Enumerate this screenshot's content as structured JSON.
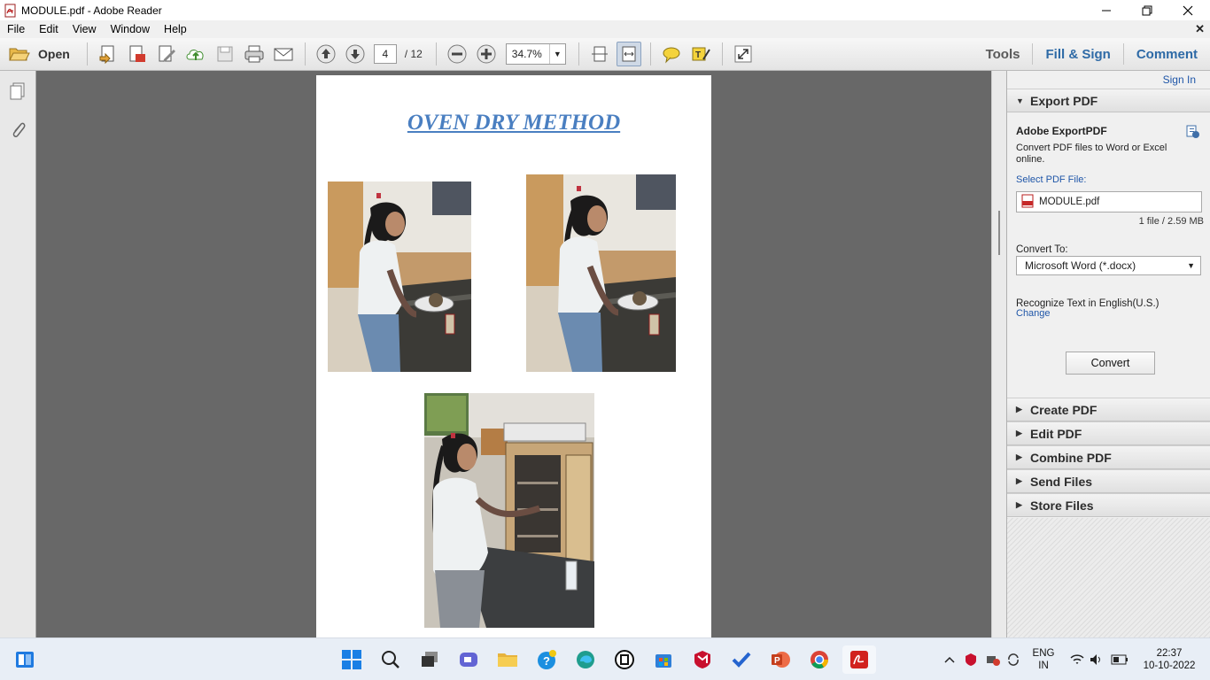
{
  "window": {
    "title": "MODULE.pdf - Adobe Reader"
  },
  "menu": {
    "items": [
      "File",
      "Edit",
      "View",
      "Window",
      "Help"
    ]
  },
  "toolbar": {
    "open_label": "Open",
    "page_current": "4",
    "page_total": "/ 12",
    "zoom": "34.7%",
    "tools_label": "Tools",
    "fill_sign_label": "Fill & Sign",
    "comment_label": "Comment"
  },
  "document": {
    "heading": "OVEN DRY METHOD"
  },
  "panel": {
    "sign_in": "Sign In",
    "export_title": "Export PDF",
    "export_heading": "Adobe ExportPDF",
    "export_desc": "Convert PDF files to Word or Excel online.",
    "select_label": "Select PDF File:",
    "file_name": "MODULE.pdf",
    "file_info": "1 file / 2.59 MB",
    "convert_to_label": "Convert To:",
    "convert_to_value": "Microsoft Word (*.docx)",
    "recognize_text": "Recognize Text in English(U.S.)",
    "change_link": "Change",
    "convert_button": "Convert",
    "sections": [
      "Create PDF",
      "Edit PDF",
      "Combine PDF",
      "Send Files",
      "Store Files"
    ]
  },
  "taskbar": {
    "lang_line1": "ENG",
    "lang_line2": "IN",
    "time": "22:37",
    "date": "10-10-2022"
  }
}
